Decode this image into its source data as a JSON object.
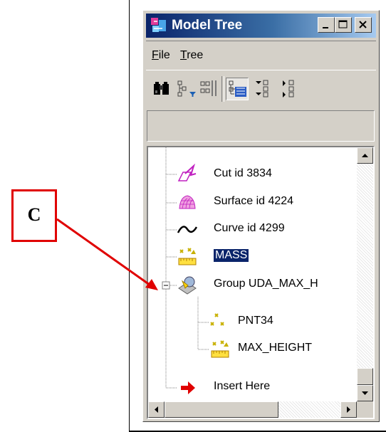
{
  "window": {
    "title": "Model Tree",
    "title_buttons": [
      "minimize-icon",
      "maximize-icon",
      "close-icon"
    ]
  },
  "menu": [
    {
      "label": "File",
      "mnemonic": "F",
      "rest": "ile"
    },
    {
      "label": "Tree",
      "mnemonic": "T",
      "rest": "ree"
    }
  ],
  "toolbar": [
    "binoculars-icon",
    "tree-filter-icon",
    "tree-columns-icon",
    "model-tree-icon",
    "expand-all-icon",
    "collapse-all-icon"
  ],
  "tree": {
    "items": [
      {
        "label": "Cut id 3834",
        "icon": "cut-feature-icon"
      },
      {
        "label": "Surface id 4224",
        "icon": "surface-feature-icon"
      },
      {
        "label": "Curve id 4299",
        "icon": "curve-feature-icon"
      },
      {
        "label": "MASS",
        "icon": "analysis-feature-icon",
        "selected": true
      },
      {
        "label": "Group UDA_MAX_H",
        "icon": "group-feature-icon",
        "expanded": true
      },
      {
        "label": "PNT34",
        "icon": "datum-point-icon"
      },
      {
        "label": "MAX_HEIGHT",
        "icon": "analysis-feature-icon"
      },
      {
        "label": "Insert Here",
        "icon": "insert-here-arrow-icon"
      }
    ]
  },
  "callout": {
    "label": "C",
    "color": "#e00000"
  },
  "colors": {
    "titlebar_start": "#0a246a",
    "titlebar_end": "#a6caf0",
    "selection": "#0a246a",
    "callout": "#e00000"
  }
}
